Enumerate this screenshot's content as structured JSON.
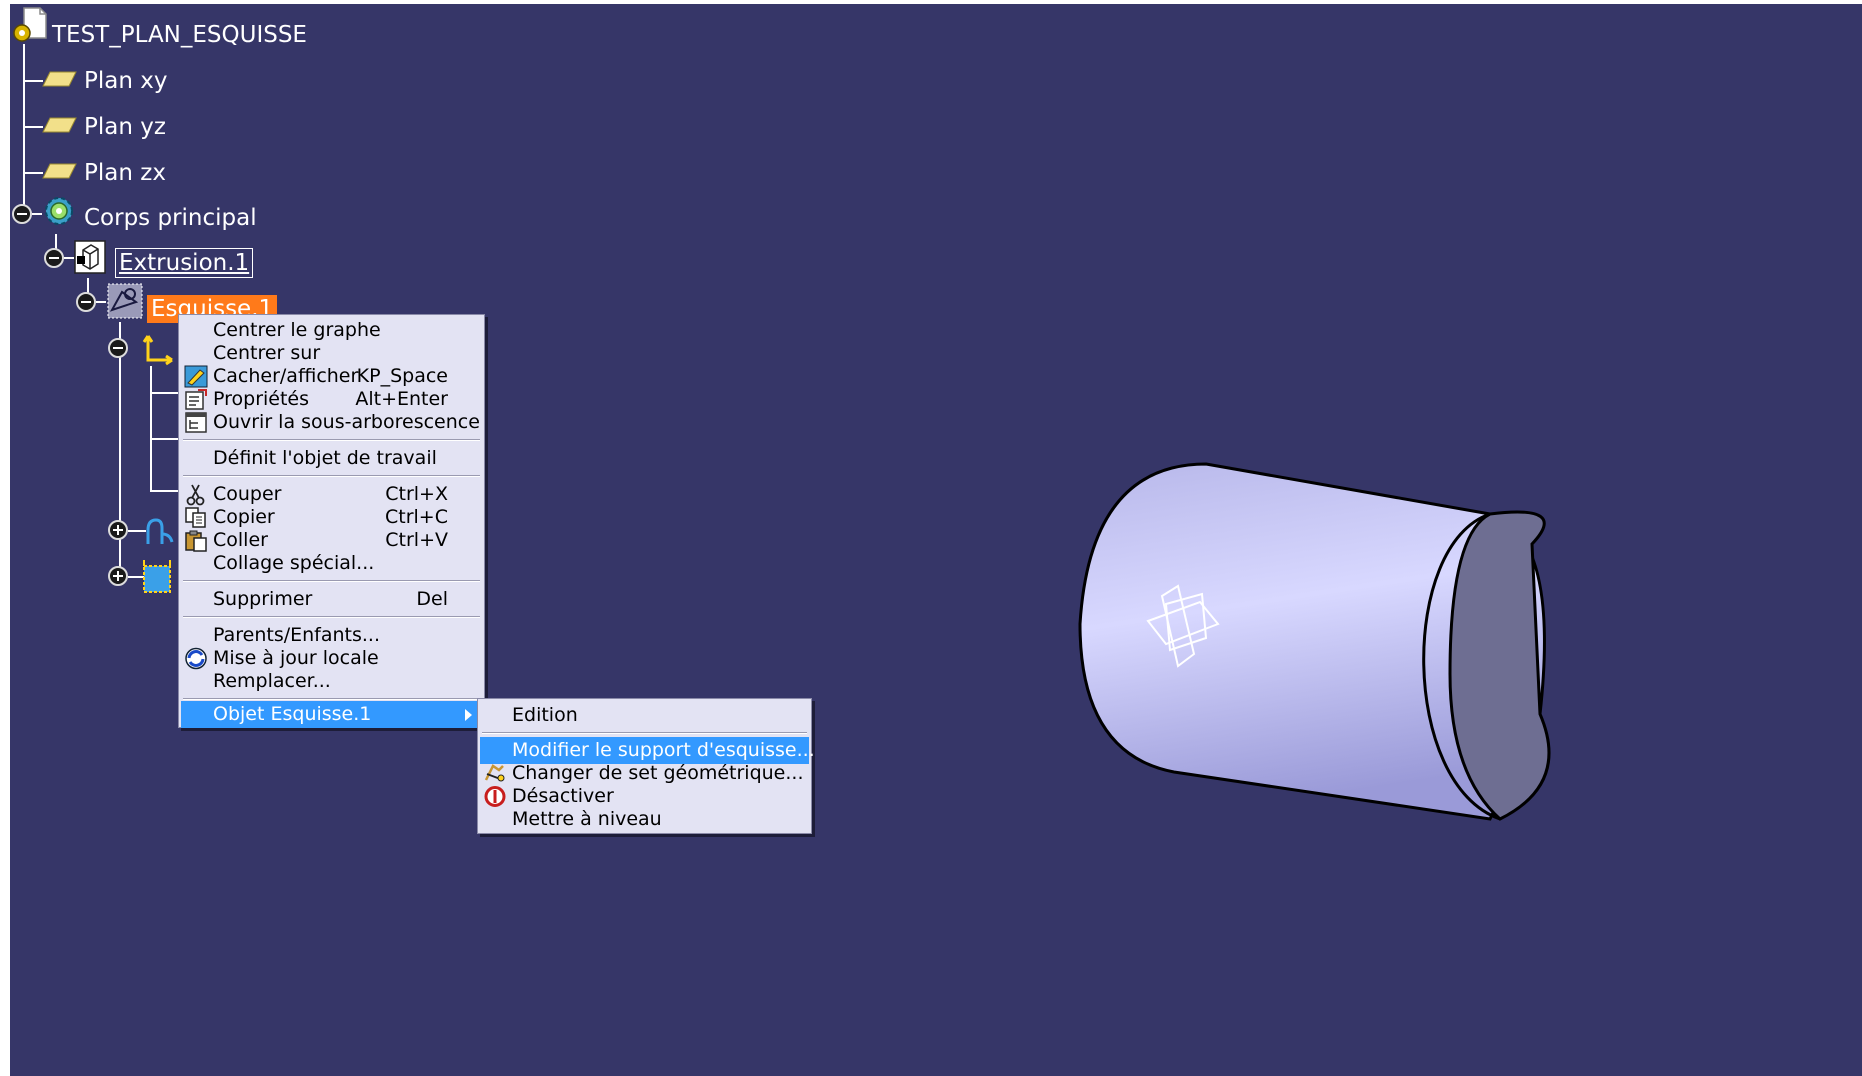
{
  "tree": {
    "root": "TEST_PLAN_ESQUISSE",
    "items": [
      "Plan xy",
      "Plan yz",
      "Plan zx",
      "Corps principal",
      "Extrusion.1",
      "Esquisse.1"
    ]
  },
  "context_menu": {
    "items": [
      {
        "label": "Centrer le graphe",
        "shortcut": ""
      },
      {
        "label": "Centrer sur",
        "shortcut": ""
      },
      {
        "label": "Cacher/afficher",
        "shortcut": "KP_Space"
      },
      {
        "label": "Propriétés",
        "shortcut": "Alt+Enter"
      },
      {
        "label": "Ouvrir la sous-arborescence",
        "shortcut": ""
      },
      {
        "label": "Définit l'objet de travail",
        "shortcut": ""
      },
      {
        "label": "Couper",
        "shortcut": "Ctrl+X"
      },
      {
        "label": "Copier",
        "shortcut": "Ctrl+C"
      },
      {
        "label": "Coller",
        "shortcut": "Ctrl+V"
      },
      {
        "label": "Collage spécial...",
        "shortcut": ""
      },
      {
        "label": "Supprimer",
        "shortcut": "Del"
      },
      {
        "label": "Parents/Enfants...",
        "shortcut": ""
      },
      {
        "label": "Mise à jour locale",
        "shortcut": ""
      },
      {
        "label": "Remplacer...",
        "shortcut": ""
      },
      {
        "label": "Objet Esquisse.1",
        "shortcut": ""
      }
    ]
  },
  "submenu": {
    "items": [
      {
        "label": "Edition"
      },
      {
        "label": "Modifier le support d'esquisse..."
      },
      {
        "label": "Changer de set géométrique..."
      },
      {
        "label": "Désactiver"
      },
      {
        "label": "Mettre à niveau"
      }
    ]
  },
  "colors": {
    "background": "#363668",
    "highlight": "#3399ff",
    "selected_node": "#ff7a1a",
    "menu_background": "#e3e3f3",
    "cylinder": "#c8c8f0"
  }
}
